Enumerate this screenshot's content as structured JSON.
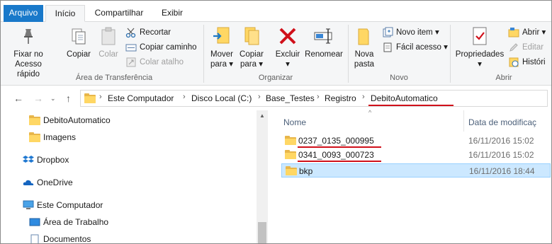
{
  "ribbon_tabs": {
    "file": "Arquivo",
    "home": "Início",
    "share": "Compartilhar",
    "view": "Exibir"
  },
  "clipboard": {
    "pin_line1": "Fixar no",
    "pin_line2": "Acesso rápido",
    "copy": "Copiar",
    "paste": "Colar",
    "cut": "Recortar",
    "copy_path": "Copiar caminho",
    "paste_shortcut": "Colar atalho",
    "group": "Área de Transferência"
  },
  "organize": {
    "move_line1": "Mover",
    "move_line2": "para",
    "copy_line1": "Copiar",
    "copy_line2": "para",
    "delete": "Excluir",
    "rename": "Renomear",
    "group": "Organizar"
  },
  "new": {
    "new_folder_line1": "Nova",
    "new_folder_line2": "pasta",
    "new_item": "Novo item",
    "easy_access": "Fácil acesso",
    "group": "Novo"
  },
  "open": {
    "properties": "Propriedades",
    "open": "Abrir",
    "edit": "Editar",
    "history": "Históri",
    "group": "Abrir"
  },
  "address": {
    "crumbs": [
      "Este Computador",
      "Disco Local (C:)",
      "Base_Testes",
      "Registro",
      "DebitoAutomatico"
    ]
  },
  "nav_tree": [
    {
      "label": "DebitoAutomatico",
      "icon": "folder-icon"
    },
    {
      "label": "Imagens",
      "icon": "folder-icon"
    },
    {
      "label": "Dropbox",
      "icon": "dropbox-icon"
    },
    {
      "label": "OneDrive",
      "icon": "onedrive-icon"
    },
    {
      "label": "Este Computador",
      "icon": "computer-icon"
    },
    {
      "label": "Área de Trabalho",
      "icon": "desktop-icon"
    },
    {
      "label": "Documentos",
      "icon": "documents-icon"
    }
  ],
  "file_list": {
    "col_name": "Nome",
    "col_date": "Data de modificaç",
    "rows": [
      {
        "name": "0237_0135_000995",
        "date": "16/11/2016 15:02"
      },
      {
        "name": "0341_0093_000723",
        "date": "16/11/2016 15:02"
      },
      {
        "name": "bkp",
        "date": "16/11/2016 18:44"
      }
    ]
  },
  "colors": {
    "accent": "#1979ca",
    "selection": "#cce8ff",
    "annotation_red": "#d0101a",
    "folder_yellow": "#ffd764"
  }
}
